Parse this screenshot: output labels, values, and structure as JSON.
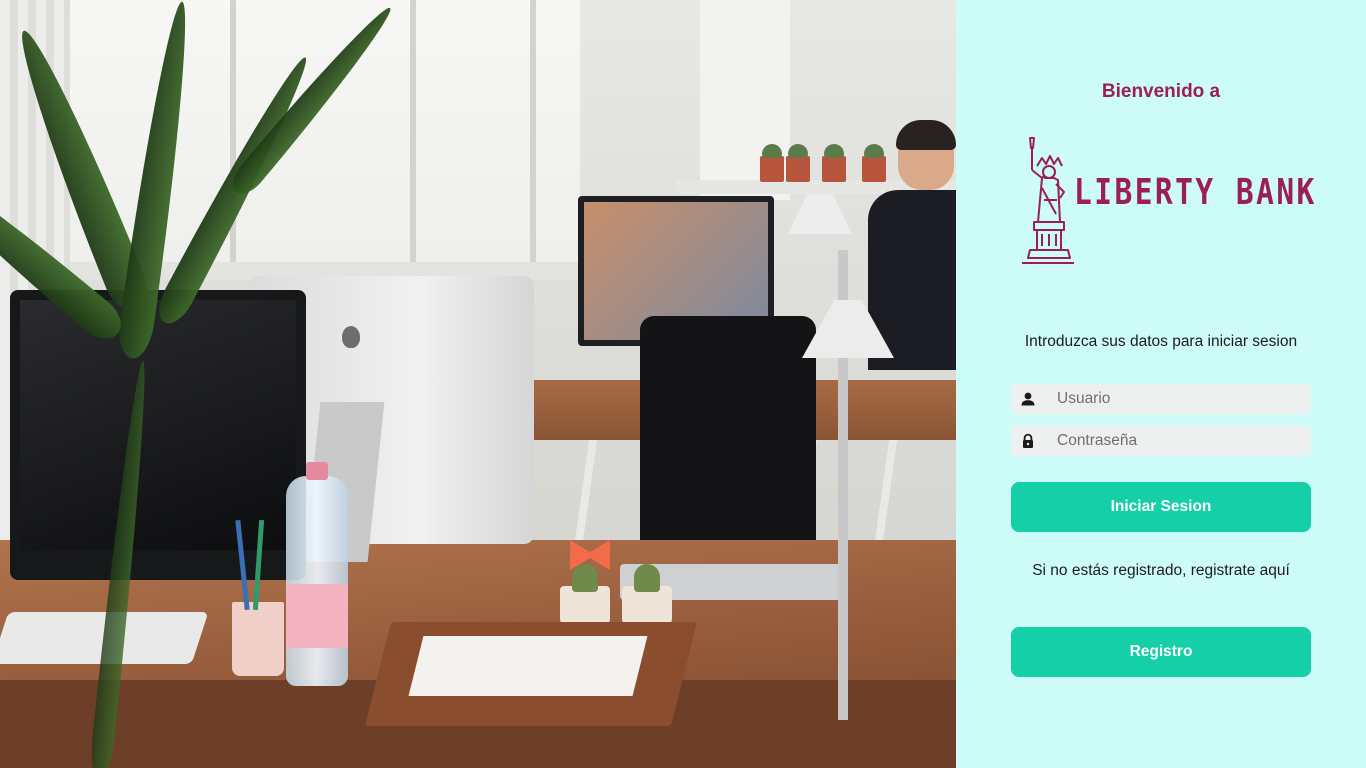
{
  "login": {
    "welcome": "Bienvenido a",
    "brand": "LIBERTY BANK",
    "intro": "Introduzca sus datos para iniciar sesion",
    "username": {
      "placeholder": "Usuario",
      "value": "",
      "icon": "user-icon"
    },
    "password": {
      "placeholder": "Contraseña",
      "value": "",
      "icon": "lock-icon"
    },
    "login_button": "Iniciar Sesion",
    "register_prompt": "Si no estás registrado, registrate aquí",
    "register_button": "Registro"
  },
  "colors": {
    "panel_background": "#cdfbf8",
    "brand": "#9b1f52",
    "button": "#15cfa9",
    "field_background": "#eef0f0"
  }
}
